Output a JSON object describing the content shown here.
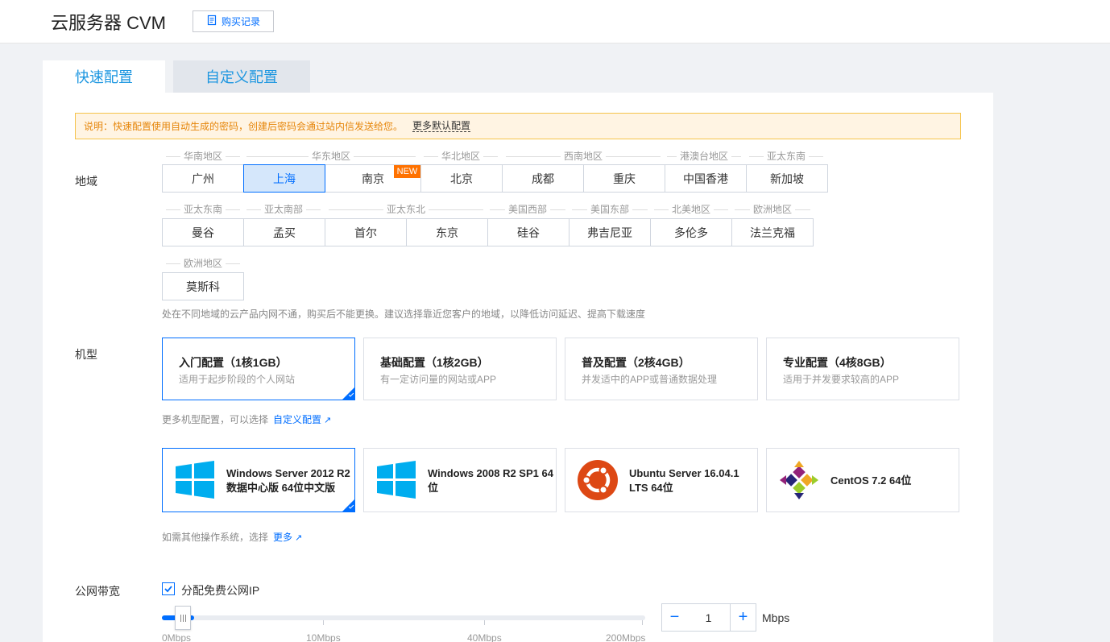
{
  "header": {
    "title": "云服务器 CVM",
    "purchase_record_label": "购买记录"
  },
  "tabs": [
    {
      "label": "快速配置",
      "active": true
    },
    {
      "label": "自定义配置",
      "active": false
    }
  ],
  "notice": {
    "text": "说明：快速配置使用自动生成的密码，创建后密码会通过站内信发送给您。",
    "link": "更多默认配置"
  },
  "region": {
    "label": "地域",
    "badge": "NEW",
    "groups": [
      {
        "name": "华南地区"
      },
      {
        "name": "华东地区"
      },
      {
        "name": "华北地区"
      },
      {
        "name": "西南地区"
      },
      {
        "name": "港澳台地区"
      },
      {
        "name": "亚太东南"
      },
      {
        "name": "亚太东南"
      },
      {
        "name": "亚太南部"
      },
      {
        "name": "亚太东北"
      },
      {
        "name": "美国西部"
      },
      {
        "name": "美国东部"
      },
      {
        "name": "北美地区"
      },
      {
        "name": "欧洲地区"
      },
      {
        "name": "欧洲地区"
      }
    ],
    "cities": [
      {
        "name": "广州"
      },
      {
        "name": "上海",
        "selected": true
      },
      {
        "name": "南京"
      },
      {
        "name": "北京"
      },
      {
        "name": "成都"
      },
      {
        "name": "重庆"
      },
      {
        "name": "中国香港"
      },
      {
        "name": "新加坡"
      },
      {
        "name": "曼谷"
      },
      {
        "name": "孟买"
      },
      {
        "name": "首尔"
      },
      {
        "name": "东京"
      },
      {
        "name": "硅谷"
      },
      {
        "name": "弗吉尼亚"
      },
      {
        "name": "多伦多"
      },
      {
        "name": "法兰克福"
      },
      {
        "name": "莫斯科"
      }
    ],
    "hint": "处在不同地域的云产品内网不通，购买后不能更换。建议选择靠近您客户的地域，以降低访问延迟、提高下载速度"
  },
  "model": {
    "label": "机型",
    "options": [
      {
        "title": "入门配置（1核1GB）",
        "desc": "适用于起步阶段的个人网站",
        "selected": true
      },
      {
        "title": "基础配置（1核2GB）",
        "desc": "有一定访问量的网站或APP",
        "selected": false
      },
      {
        "title": "普及配置（2核4GB）",
        "desc": "并发适中的APP或普通数据处理",
        "selected": false
      },
      {
        "title": "专业配置（4核8GB）",
        "desc": "适用于并发要求较高的APP",
        "selected": false
      }
    ],
    "more_text": "更多机型配置，可以选择",
    "more_link": "自定义配置"
  },
  "os": {
    "options": [
      {
        "name": "Windows Server 2012 R2 数据中心版 64位中文版",
        "icon": "windows-icon",
        "selected": true
      },
      {
        "name": "Windows 2008 R2 SP1 64位",
        "icon": "windows-icon",
        "selected": false
      },
      {
        "name": "Ubuntu Server 16.04.1 LTS 64位",
        "icon": "ubuntu-icon",
        "selected": false
      },
      {
        "name": "CentOS 7.2 64位",
        "icon": "centos-icon",
        "selected": false
      }
    ],
    "more_text": "如需其他操作系统，选择",
    "more_link": "更多"
  },
  "bandwidth": {
    "label": "公网带宽",
    "checkbox_label": "分配免费公网IP",
    "checked": true,
    "value": "1",
    "unit": "Mbps",
    "minus": "−",
    "plus": "+",
    "slider_level": 1,
    "ticks": [
      "0Mbps",
      "10Mbps",
      "40Mbps",
      "200Mbps"
    ]
  },
  "colors": {
    "accent": "#006eff",
    "windows": "#00adef",
    "ubuntu": "#dd4814",
    "badge": "#ff7200"
  }
}
